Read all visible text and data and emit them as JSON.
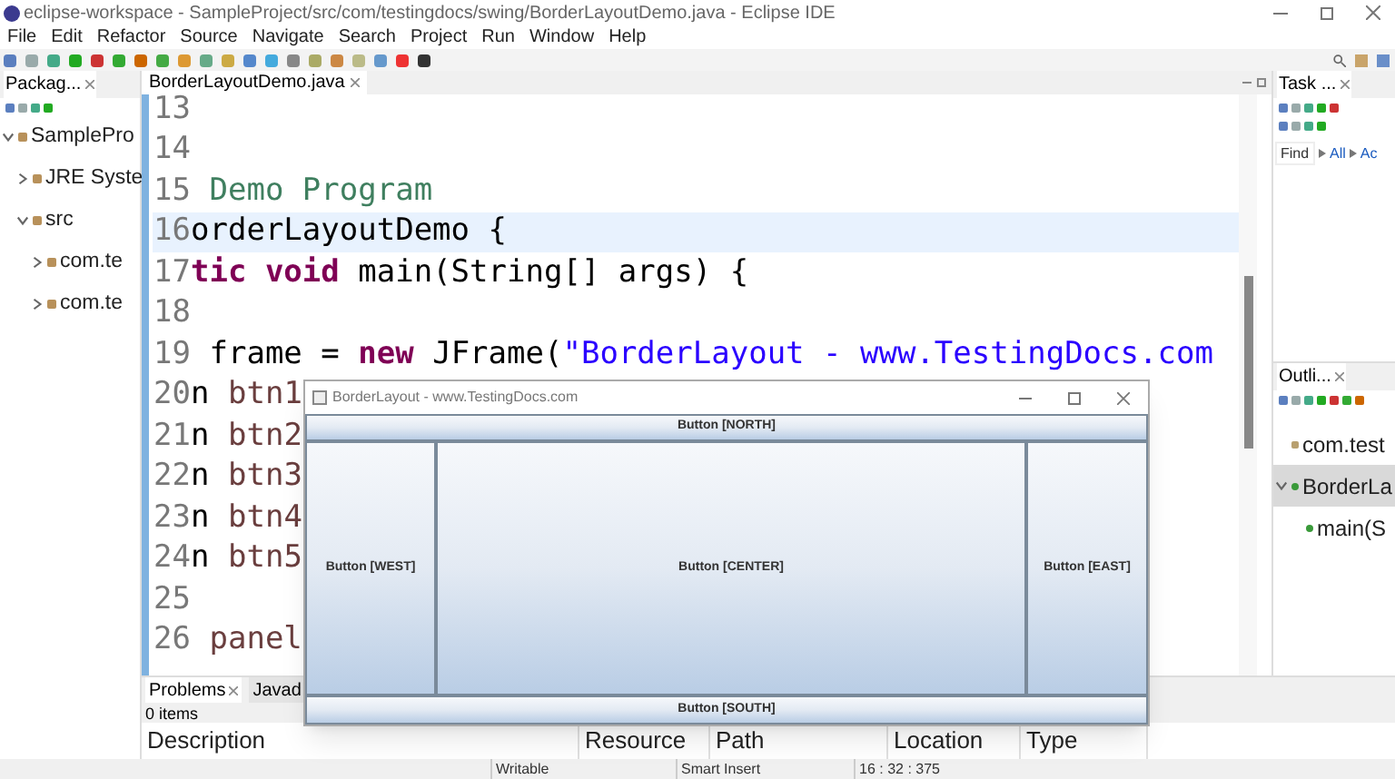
{
  "window": {
    "title": "eclipse-workspace - SampleProject/src/com/testingdocs/swing/BorderLayoutDemo.java - Eclipse IDE"
  },
  "menu": [
    "File",
    "Edit",
    "Refactor",
    "Source",
    "Navigate",
    "Search",
    "Project",
    "Run",
    "Window",
    "Help"
  ],
  "package_explorer": {
    "tab": "Packag...",
    "tree": [
      {
        "label": "SamplePro",
        "expanded": true,
        "children": [
          {
            "label": "JRE Syste",
            "expanded": false
          },
          {
            "label": "src",
            "expanded": true,
            "children": [
              {
                "label": "com.te",
                "expanded": false
              },
              {
                "label": "com.te",
                "expanded": false
              }
            ]
          }
        ]
      }
    ]
  },
  "editor": {
    "tab": "BorderLayoutDemo.java",
    "lines": [
      {
        "number": "13",
        "current": false
      },
      {
        "number": "14",
        "current": false
      },
      {
        "number": "15",
        "current": false,
        "tokens": [
          {
            "text": " Demo Program",
            "kind": "comment"
          }
        ]
      },
      {
        "number": "16",
        "current": true,
        "tokens": [
          {
            "text": "orderLayoutDemo {",
            "kind": "plain"
          }
        ]
      },
      {
        "number": "17",
        "current": false,
        "tokens": [
          {
            "text": "tic void",
            "kind": "keyword"
          },
          {
            "text": " main(String[] args) {",
            "kind": "plain"
          }
        ]
      },
      {
        "number": "18",
        "current": false
      },
      {
        "number": "19",
        "current": false,
        "tokens": [
          {
            "text": " frame = ",
            "kind": "plain"
          },
          {
            "text": "new",
            "kind": "keyword"
          },
          {
            "text": " JFrame(",
            "kind": "plain"
          },
          {
            "text": "\"BorderLayout - www.TestingDocs.com",
            "kind": "string"
          }
        ]
      },
      {
        "number": "20",
        "current": false,
        "tokens": [
          {
            "text": "n ",
            "kind": "plain"
          },
          {
            "text": "btn1",
            "kind": "field"
          }
        ]
      },
      {
        "number": "21",
        "current": false,
        "tokens": [
          {
            "text": "n ",
            "kind": "plain"
          },
          {
            "text": "btn2",
            "kind": "field"
          }
        ]
      },
      {
        "number": "22",
        "current": false,
        "tokens": [
          {
            "text": "n ",
            "kind": "plain"
          },
          {
            "text": "btn3",
            "kind": "field"
          }
        ]
      },
      {
        "number": "23",
        "current": false,
        "tokens": [
          {
            "text": "n ",
            "kind": "plain"
          },
          {
            "text": "btn4",
            "kind": "field"
          }
        ]
      },
      {
        "number": "24",
        "current": false,
        "tokens": [
          {
            "text": "n ",
            "kind": "plain"
          },
          {
            "text": "btn5",
            "kind": "field"
          }
        ]
      },
      {
        "number": "25",
        "current": false
      },
      {
        "number": "26",
        "current": false,
        "tokens": [
          {
            "text": " panel",
            "kind": "field"
          }
        ]
      }
    ]
  },
  "task_list": {
    "tab": "Task ...",
    "find": {
      "placeholder": "Find"
    },
    "filters": [
      "All",
      "Ac"
    ]
  },
  "outline": {
    "tab": "Outli...",
    "items": [
      {
        "label": "com.test",
        "kind": "package",
        "selected": false
      },
      {
        "label": "BorderLa",
        "kind": "class",
        "selected": true,
        "expanded": true,
        "children": [
          {
            "label": "main(S",
            "kind": "method",
            "selected": false
          }
        ]
      }
    ]
  },
  "bottom_panel": {
    "tabs": [
      {
        "label": "Problems",
        "selected": true
      },
      {
        "label": "Javad",
        "selected": false
      }
    ],
    "count": "0 items",
    "columns": [
      "Description",
      "Resource",
      "Path",
      "Location",
      "Type"
    ]
  },
  "status_bar": [
    "Writable",
    "Smart Insert",
    "16 : 32 : 375"
  ],
  "swing_window": {
    "title": "BorderLayout - www.TestingDocs.com",
    "buttons": {
      "north": "Button [NORTH]",
      "west": "Button [WEST]",
      "center": "Button [CENTER]",
      "east": "Button [EAST]",
      "south": "Button [SOUTH]"
    }
  }
}
